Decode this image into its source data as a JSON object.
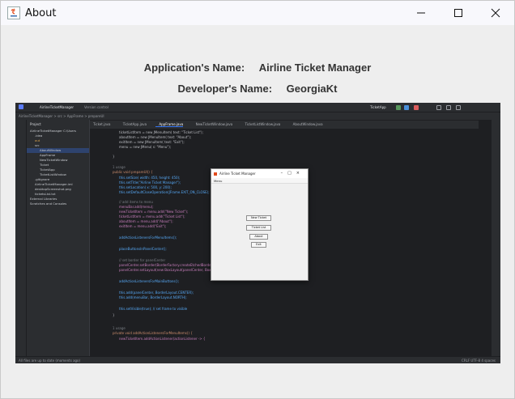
{
  "window": {
    "title": "About",
    "controls": [
      "minimize-icon",
      "maximize-icon",
      "close-icon"
    ]
  },
  "about": {
    "app_name_label": "Application's Name:",
    "app_name_value": "Airline Ticket Manager",
    "dev_name_label": "Developer's Name:",
    "dev_name_value": "GeorgiaKt"
  },
  "screenshot": {
    "ide_title": "AirlineTicketManager",
    "ide_vcs": "Version control",
    "ide_run_config": "TicketApp",
    "breadcrumb": "AirlineTicketManager > src > AppFrame > prepareUI",
    "tabs": [
      "Ticket.java",
      "TicketApp.java",
      "AppFrame.java",
      "NewTicketWindow.java",
      "TicketListWindow.java",
      "AboutWindow.java"
    ],
    "project_header": "Project",
    "project_tree": [
      "AirlineTicketManager C:\\Users",
      ".idea",
      "out",
      "src",
      "AboutWindow",
      "AppFrame",
      "NewTicketWindow",
      "Ticket",
      "TicketApp",
      "TicketListWindow",
      ".gitignore",
      "AirlineTicketManager.iml",
      "desktopScreenshot.png",
      "ticketsList.txt",
      "External Libraries",
      "Scratches and Consoles"
    ],
    "code_lines": [
      "ticketListItem = new JMenuItem( text: \"Ticket List\");",
      "aboutItem = new JMenuItem( text: \"About\");",
      "exitItem = new JMenuItem( text: \"Exit\");",
      "menu = new JMenu( s: \"Menu\");",
      "}",
      "1 usage",
      "public void prepareUI() {",
      "this.setSize( width: 450,  height: 450);",
      "this.setTitle(\"Airline Ticket Manager\");",
      "this.setLocation( x: 500,  y: 200);",
      "this.setDefaultCloseOperation(JFrame.EXIT_ON_CLOSE);",
      "// add items to menu",
      "menuBar.add(menu);",
      "newTicketItem = menu.add(\"New Ticket\");",
      "ticketListItem = menu.add(\"Ticket List\");",
      "aboutItem = menu.add(\"About\");",
      "exitItem = menu.add(\"Exit\");",
      "addActionListenersForMenuItems();",
      "placeButtonsInPanelCenter();",
      "// set border for panelCenter",
      "panelCenter.setBorder(BorderFactory.createEtchedBorder());",
      "panelCenter.setLayout(new BoxLayout(panelCenter, BoxLayout.PAGE_AXIS));",
      "addActionListenersForMainButtons();",
      "this.add(panelCenter, BorderLayout.CENTER);",
      "this.add(menuBar, BorderLayout.NORTH);",
      "this.setVisible(true); // set frame to visible",
      "}",
      "1 usage",
      "private void addActionListenersForMenuItems() {",
      "newTicketItem.addActionListener(actionListener -> {"
    ],
    "status_left": "All files are up to date (moments ago)",
    "status_right": "CRLF   UTF-8   4 spaces",
    "ticket_window": {
      "title": "Airline Ticket Manager",
      "menu": "Menu",
      "buttons": [
        "New Ticket",
        "Ticket List",
        "About",
        "Exit"
      ]
    }
  },
  "colors": {
    "background": "#eeeeee",
    "ide_background": "#1e1f22",
    "ide_panel": "#2b2d30"
  }
}
